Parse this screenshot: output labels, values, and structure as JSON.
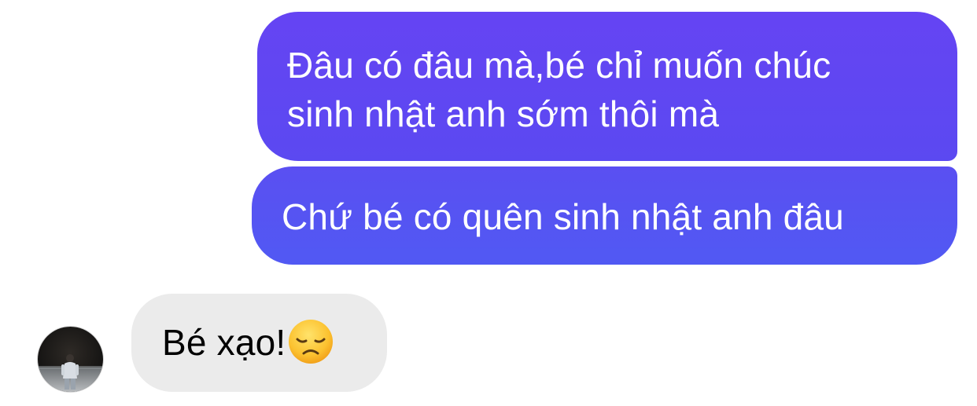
{
  "conversation": {
    "messages": [
      {
        "direction": "outgoing",
        "lines": [
          "Đâu có đâu mà,bé chỉ muốn chúc",
          "sinh nhật anh sớm thôi mà"
        ]
      },
      {
        "direction": "outgoing",
        "text": "Chứ bé có quên sinh nhật anh đâu"
      },
      {
        "direction": "incoming",
        "text": "Bé xạo!",
        "emoji": "disappointed-face-emoji"
      }
    ],
    "contact_avatar": "contact-avatar-photo"
  },
  "colors": {
    "outgoing_bubble_top": "#6544f3",
    "outgoing_bubble_bottom": "#5159f3",
    "incoming_bubble": "#ebebeb",
    "background": "#ffffff"
  }
}
